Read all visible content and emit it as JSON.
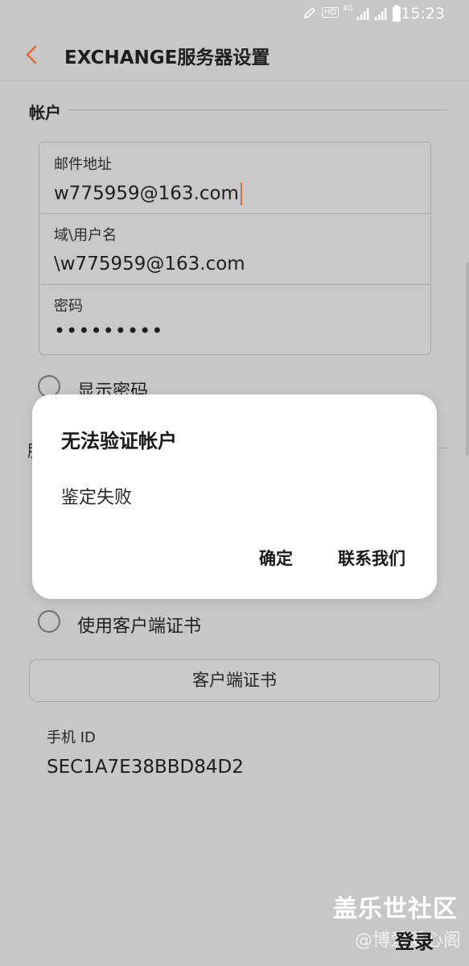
{
  "status_bar": {
    "time": "15:23",
    "icons": [
      "pen-icon",
      "hd-icon",
      "4g-icon",
      "signal-icon",
      "signal-icon",
      "battery-icon"
    ],
    "hd_label": "HD",
    "network_label": "4G"
  },
  "header": {
    "title": "EXCHANGE服务器设置",
    "back_icon": "chevron-left-icon",
    "accent_color": "#e0693b"
  },
  "account_section": {
    "title": "帐户",
    "fields": [
      {
        "label": "邮件地址",
        "value": "w775959@163.com"
      },
      {
        "label": "域\\用户名",
        "value": "\\w775959@163.com"
      },
      {
        "label": "密码",
        "value": "•••••••••"
      }
    ]
  },
  "show_password": {
    "label": "显示密码",
    "checked": false
  },
  "hidden_section_initial": "服",
  "client_cert_checkbox": {
    "label": "使用客户端证书",
    "checked": false
  },
  "client_cert_button": {
    "label": "客户端证书"
  },
  "phone_id": {
    "label": "手机 ID",
    "value": "SEC1A7E38BBD84D2"
  },
  "dialog": {
    "title": "无法验证帐户",
    "message": "鉴定失败",
    "buttons": {
      "confirm": "确定",
      "contact": "联系我们"
    }
  },
  "footer": {
    "login_label": "登录",
    "watermark_line1": "盖乐世社区",
    "watermark_line2": "@博爱爱心阁"
  }
}
